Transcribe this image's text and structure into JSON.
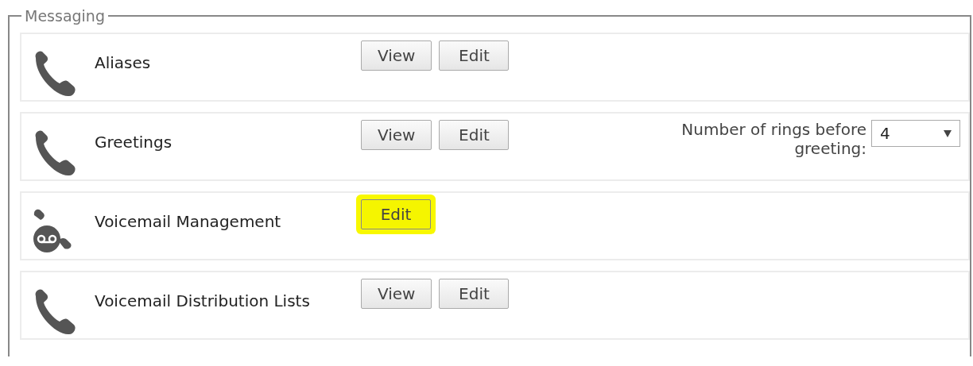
{
  "section": {
    "legend": "Messaging"
  },
  "rows": [
    {
      "kind": "phone",
      "label": "Aliases",
      "buttons": [
        {
          "label": "View",
          "highlighted": false
        },
        {
          "label": "Edit",
          "highlighted": false
        }
      ]
    },
    {
      "kind": "phone",
      "label": "Greetings",
      "buttons": [
        {
          "label": "View",
          "highlighted": false
        },
        {
          "label": "Edit",
          "highlighted": false
        }
      ],
      "setting": {
        "label": "Number of rings before greeting:",
        "value": "4"
      }
    },
    {
      "kind": "voicemail",
      "label": "Voicemail Management",
      "buttons": [
        {
          "label": "Edit",
          "highlighted": true
        }
      ]
    },
    {
      "kind": "phone",
      "label": "Voicemail Distribution Lists",
      "buttons": [
        {
          "label": "View",
          "highlighted": false
        },
        {
          "label": "Edit",
          "highlighted": false
        }
      ]
    }
  ]
}
